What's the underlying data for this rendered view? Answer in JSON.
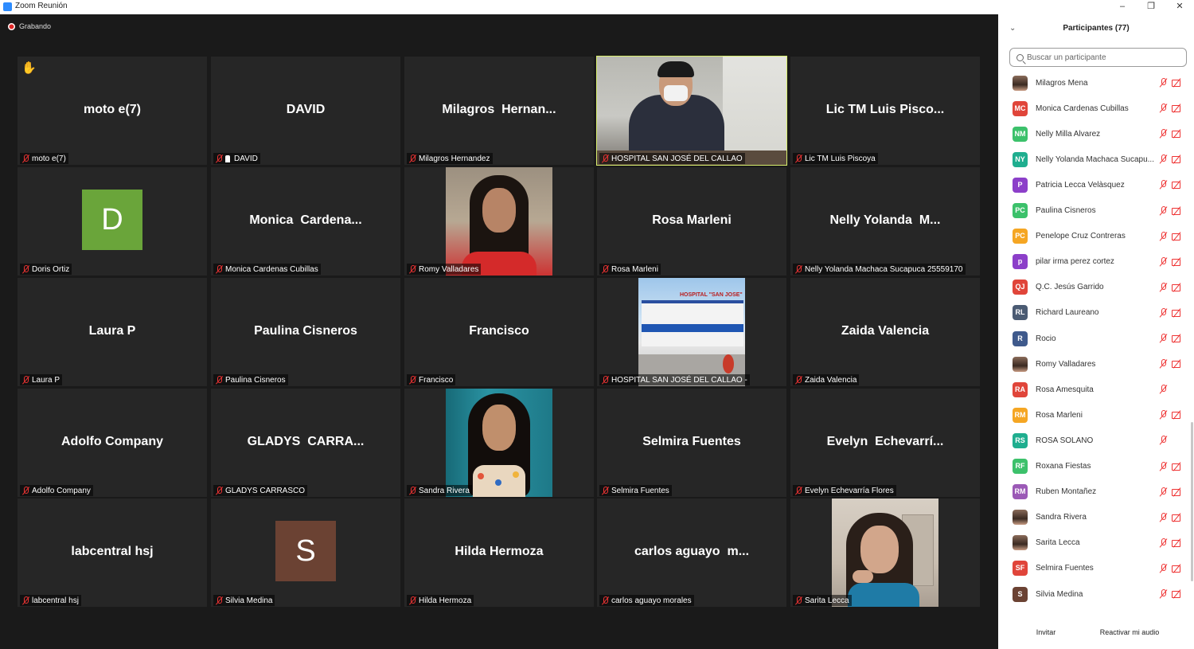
{
  "window": {
    "title": "Zoom Reunión"
  },
  "meeting": {
    "recording_label": "Grabando",
    "tiles": [
      {
        "big": "moto e(7)",
        "tag": "moto e(7)",
        "hand": true
      },
      {
        "big": "DAVID",
        "tag": "DAVID",
        "pin": true
      },
      {
        "big": "Milagros  Hernan...",
        "tag": "Milagros Hernandez"
      },
      {
        "tag": "HOSPITAL SAN JOSÉ DEL CALLAO",
        "video": "office",
        "active": true
      },
      {
        "big": "Lic TM Luis Pisco...",
        "tag": "Lic TM Luis Piscoya"
      },
      {
        "avatar": "D",
        "avatar_color": "#6aa53a",
        "tag": "Doris Ortiz"
      },
      {
        "big": "Monica  Cardena...",
        "tag": "Monica Cardenas Cubillas"
      },
      {
        "tag": "Romy Valladares",
        "video": "person-red"
      },
      {
        "big": "Rosa Marleni",
        "tag": "Rosa Marleni"
      },
      {
        "big": "Nelly Yolanda  M...",
        "tag": "Nelly Yolanda Machaca Sucapuca 25559170"
      },
      {
        "big": "Laura P",
        "tag": "Laura P"
      },
      {
        "big": "Paulina Cisneros",
        "tag": "Paulina Cisneros"
      },
      {
        "big": "Francisco",
        "tag": "Francisco"
      },
      {
        "tag": "HOSPITAL SAN JOSÉ DEL CALLAO -",
        "video": "hospital",
        "video_text": "HOSPITAL \"SAN JOSE\""
      },
      {
        "big": "Zaida Valencia",
        "tag": "Zaida Valencia"
      },
      {
        "big": "Adolfo Company",
        "tag": "Adolfo Company"
      },
      {
        "big": "GLADYS  CARRA...",
        "tag": "GLADYS CARRASCO"
      },
      {
        "tag": "Sandra Rivera",
        "video": "teal"
      },
      {
        "big": "Selmira Fuentes",
        "tag": "Selmira Fuentes"
      },
      {
        "big": "Evelyn  Echevarrí...",
        "tag": "Evelyn Echevarría Flores"
      },
      {
        "big": "labcentral hsj",
        "tag": "labcentral hsj"
      },
      {
        "avatar": "S",
        "avatar_color": "#6b4233",
        "tag": "Silvia Medina"
      },
      {
        "big": "Hilda Hermoza",
        "tag": "Hilda Hermoza"
      },
      {
        "big": "carlos aguayo  m...",
        "tag": "carlos aguayo morales"
      },
      {
        "tag": "Sarita Lecca",
        "video": "room"
      }
    ]
  },
  "panel": {
    "title": "Participantes (77)",
    "window_controls": [
      "–",
      "❐",
      "✕"
    ],
    "search_placeholder": "Buscar un participante",
    "participants": [
      {
        "name": "Milagros Mena",
        "photo": true,
        "cam": true
      },
      {
        "name": "Monica Cardenas Cubillas",
        "initials": "MC",
        "color": "#e0453a",
        "cam": true
      },
      {
        "name": "Nelly Milla Alvarez",
        "initials": "NM",
        "color": "#3cc16b",
        "cam": true
      },
      {
        "name": "Nelly Yolanda Machaca Sucapu...",
        "initials": "NY",
        "color": "#1fae8f",
        "cam": true
      },
      {
        "name": "Patricia Lecca Velàsquez",
        "initials": "P",
        "color": "#8c3fc9",
        "cam": true
      },
      {
        "name": "Paulina Cisneros",
        "initials": "PC",
        "color": "#3cc16b",
        "cam": true
      },
      {
        "name": "Penelope Cruz Contreras",
        "initials": "PC",
        "color": "#f5a623",
        "cam": true
      },
      {
        "name": "pilar irma perez cortez",
        "initials": "p",
        "color": "#8c3fc9",
        "cam": true
      },
      {
        "name": "Q.C. Jesús Garrido",
        "initials": "QJ",
        "color": "#e0453a",
        "cam": true
      },
      {
        "name": "Richard Laureano",
        "initials": "RL",
        "color": "#4b5b73",
        "cam": true
      },
      {
        "name": "Rocio",
        "initials": "R",
        "color": "#3f5a8c",
        "cam": true
      },
      {
        "name": "Romy Valladares",
        "photo": true,
        "cam": true
      },
      {
        "name": "Rosa Amesquita",
        "initials": "RA",
        "color": "#e0453a",
        "cam": false
      },
      {
        "name": "Rosa Marleni",
        "initials": "RM",
        "color": "#f5a623",
        "cam": true
      },
      {
        "name": "ROSA SOLANO",
        "initials": "RS",
        "color": "#1fae8f",
        "cam": false
      },
      {
        "name": "Roxana Fiestas",
        "initials": "RF",
        "color": "#3cc16b",
        "cam": true
      },
      {
        "name": "Ruben Montañez",
        "initials": "RM",
        "color": "#9b59b6",
        "cam": true
      },
      {
        "name": "Sandra Rivera",
        "photo": true,
        "cam": true
      },
      {
        "name": "Sarita Lecca",
        "photo": true,
        "cam": true
      },
      {
        "name": "Selmira Fuentes",
        "initials": "SF",
        "color": "#e0453a",
        "cam": true
      },
      {
        "name": "Silvia Medina",
        "initials": "S",
        "color": "#6b4233",
        "cam": true
      }
    ],
    "footer": {
      "invite": "Invitar",
      "unmute": "Reactivar mi audio"
    }
  }
}
